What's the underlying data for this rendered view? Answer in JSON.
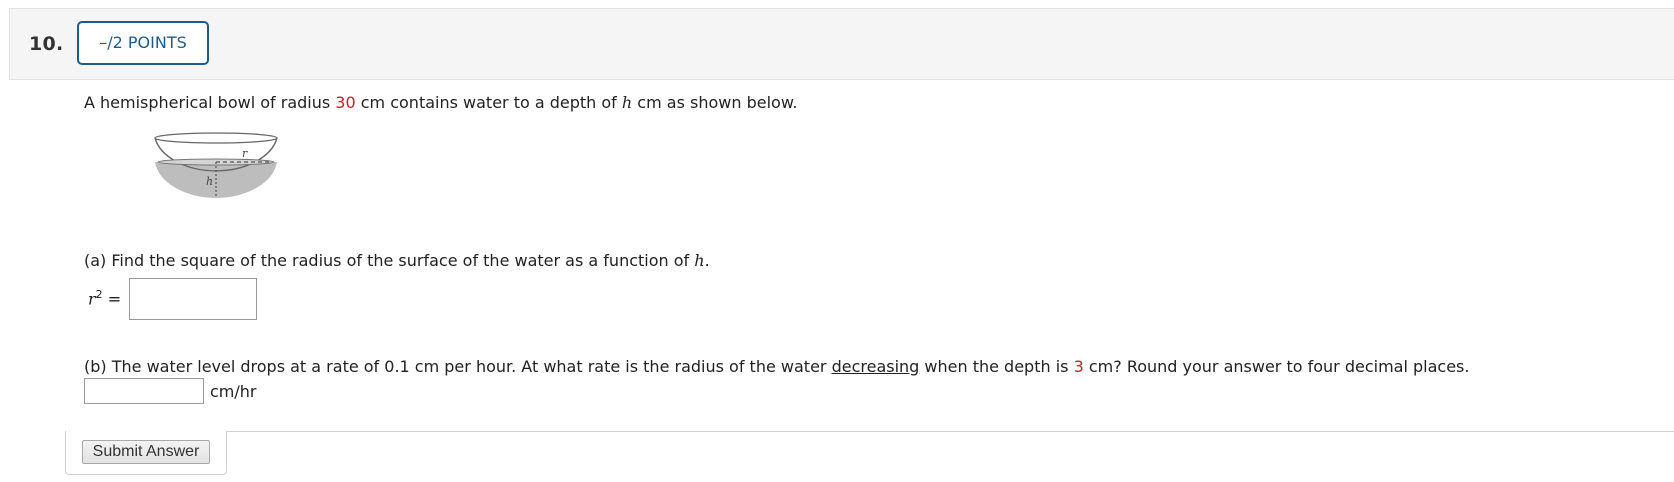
{
  "question": {
    "number": "10.",
    "points_label": "–/2 POINTS"
  },
  "intro": {
    "text_before": "A hemispherical bowl of radius ",
    "radius_value": "30",
    "text_middle": " cm contains water to a depth of ",
    "var_h": "h",
    "text_after": " cm as shown below."
  },
  "figure": {
    "label_r": "r",
    "label_h": "h"
  },
  "part_a": {
    "prompt_before": "(a) Find the square of the radius of the surface of the water as a function of ",
    "prompt_var": "h",
    "prompt_after": ".",
    "answer_var": "r",
    "answer_exp": "2",
    "answer_eq": " =",
    "answer_value": ""
  },
  "part_b": {
    "prompt_before": "(b) The water level drops at a rate of 0.1 cm per hour. At what rate is the radius of the water ",
    "prompt_underlined": "decreasing",
    "prompt_middle": " when the depth is ",
    "depth_value": "3",
    "prompt_after": " cm? Round your answer to four decimal places.",
    "answer_value": "",
    "unit": "cm/hr"
  },
  "submit": {
    "label": "Submit Answer"
  },
  "colors": {
    "accent_blue": "#1f5b86",
    "value_red": "#c4202b",
    "water_gray": "#bdbdbd"
  }
}
